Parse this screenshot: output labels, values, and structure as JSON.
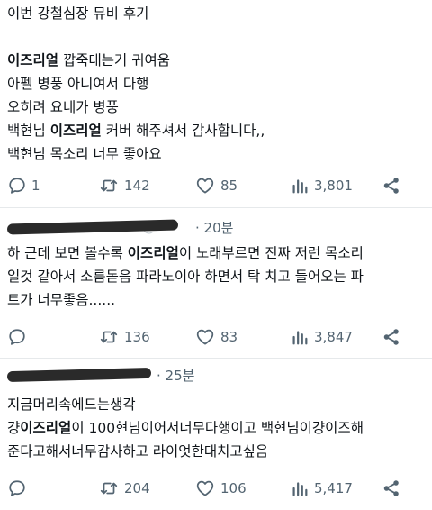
{
  "posts": [
    {
      "lines": [
        [
          {
            "t": "이번 강철심장 뮤비 후기"
          }
        ],
        [
          {
            "t": ""
          }
        ],
        [
          {
            "t": "이즈리얼",
            "b": true
          },
          {
            "t": " 깝죽대는거 귀여움"
          }
        ],
        [
          {
            "t": "아펠 병풍 아니여서 다행"
          }
        ],
        [
          {
            "t": "오히려 요네가 병풍"
          }
        ],
        [
          {
            "t": "백현님 "
          },
          {
            "t": "이즈리얼",
            "b": true
          },
          {
            "t": " 커버 해주셔서 감사합니다,,"
          }
        ],
        [
          {
            "t": "백현님 목소리 너무 좋아요"
          }
        ]
      ],
      "stats": {
        "replies": "1",
        "reposts": "142",
        "likes": "85",
        "views": "3,801"
      }
    }
  ],
  "replies": [
    {
      "user_visible": "@",
      "time": "· 20분",
      "lines": [
        [
          {
            "t": "하 근데 보면 볼수록 "
          },
          {
            "t": "이즈리얼",
            "b": true
          },
          {
            "t": "이 노래부르면 진짜 저런 목소리"
          }
        ],
        [
          {
            "t": "일것 같아서 소름돋음 파라노이아 하면서 탁 치고 들어오는 파"
          }
        ],
        [
          {
            "t": "트가 너무좋음......"
          }
        ]
      ],
      "stats": {
        "replies": "",
        "reposts": "136",
        "likes": "83",
        "views": "3,847"
      }
    },
    {
      "user_visible": "",
      "time": "· 25분",
      "lines": [
        [
          {
            "t": "지금머리속에드는생각"
          }
        ],
        [
          {
            "t": "걍"
          },
          {
            "t": "이즈리얼",
            "b": true
          },
          {
            "t": "이 100현님이어서너무다행이고 백현님이걍이즈해"
          }
        ],
        [
          {
            "t": "준다고해서너무감사하고 라이엇한대치고싶음"
          }
        ]
      ],
      "stats": {
        "replies": "",
        "reposts": "204",
        "likes": "106",
        "views": "5,417"
      }
    }
  ],
  "icons": {
    "reply": "speech-bubble-icon",
    "repost": "repost-arrows-icon",
    "like": "heart-icon",
    "views": "bar-chart-icon",
    "share": "share-nodes-icon"
  },
  "colors": {
    "text": "#0f1419",
    "muted": "#536471",
    "divider": "#e6e9eb"
  }
}
